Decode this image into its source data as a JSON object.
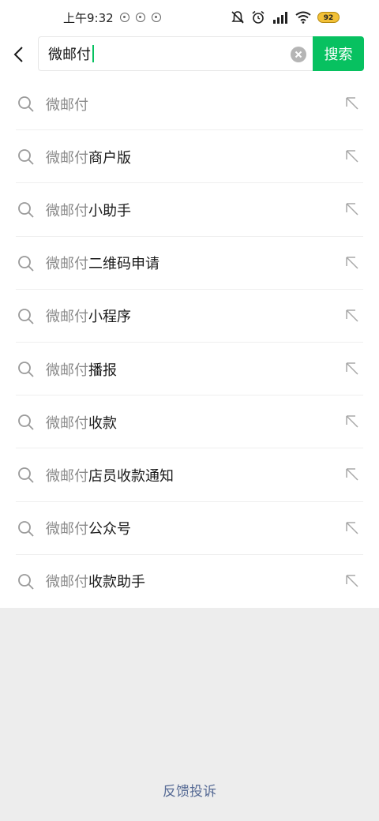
{
  "status_bar": {
    "time": "上午9:32",
    "battery": "92"
  },
  "search": {
    "query": "微邮付",
    "button_label": "搜索"
  },
  "suggestions": [
    {
      "prefix": "微邮付",
      "suffix": ""
    },
    {
      "prefix": "微邮付",
      "suffix": "商户版"
    },
    {
      "prefix": "微邮付",
      "suffix": "小助手"
    },
    {
      "prefix": "微邮付",
      "suffix": "二维码申请"
    },
    {
      "prefix": "微邮付",
      "suffix": "小程序"
    },
    {
      "prefix": "微邮付",
      "suffix": "播报"
    },
    {
      "prefix": "微邮付",
      "suffix": "收款"
    },
    {
      "prefix": "微邮付",
      "suffix": "店员收款通知"
    },
    {
      "prefix": "微邮付",
      "suffix": "公众号"
    },
    {
      "prefix": "微邮付",
      "suffix": "收款助手"
    }
  ],
  "footer": {
    "feedback_label": "反馈投诉"
  },
  "colors": {
    "accent": "#07c160",
    "link": "#576b95",
    "bottom_bg": "#ededed"
  },
  "icons": {
    "back": "chevron-left-icon",
    "clear": "clear-icon",
    "search": "search-icon",
    "fill": "arrow-up-left-icon"
  }
}
